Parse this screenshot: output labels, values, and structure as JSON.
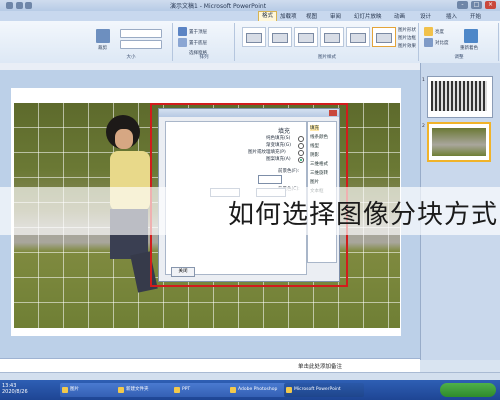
{
  "window": {
    "title": "演示文稿1 - Microsoft PowerPoint",
    "controls": [
      "-",
      "□",
      "×"
    ]
  },
  "ribbon": {
    "tabs": [
      "开始",
      "插入",
      "设计",
      "动画",
      "幻灯片放映",
      "审阅",
      "视图",
      "加载项",
      "格式"
    ],
    "active_tab": "格式",
    "groups": [
      {
        "label": "调整",
        "items": [
          "亮度",
          "对比度",
          "重新着色"
        ]
      },
      {
        "label": "图片样式",
        "items": [
          "图片形状",
          "图片边框",
          "图片效果"
        ]
      },
      {
        "label": "排列",
        "items": [
          "置于顶层",
          "置于底层",
          "选择窗格"
        ]
      },
      {
        "label": "大小",
        "items": [
          "裁剪"
        ]
      }
    ]
  },
  "dialog": {
    "heading": "填充",
    "options": [
      "纯色填充(S)",
      "渐变填充(G)",
      "图片或纹理填充(P)",
      "图案填充(A)"
    ],
    "nav": [
      "填充",
      "线条颜色",
      "线型",
      "阴影",
      "三维格式",
      "三维旋转",
      "图片",
      "文本框"
    ],
    "fg_label": "前景色(F):",
    "bg_label": "背景色(C):",
    "close_button": "关闭"
  },
  "slides": {
    "numbers": [
      "1",
      "2"
    ]
  },
  "notes": {
    "text": "单击此处添加备注"
  },
  "taskbar": {
    "clock": "13:43\n2020/8/26",
    "buttons": [
      "Microsoft PowerPoint",
      "Adobe Photoshop",
      "PPT",
      "新建文件夹",
      "图片"
    ]
  },
  "caption": {
    "text": "如何选择图像分块方式"
  }
}
